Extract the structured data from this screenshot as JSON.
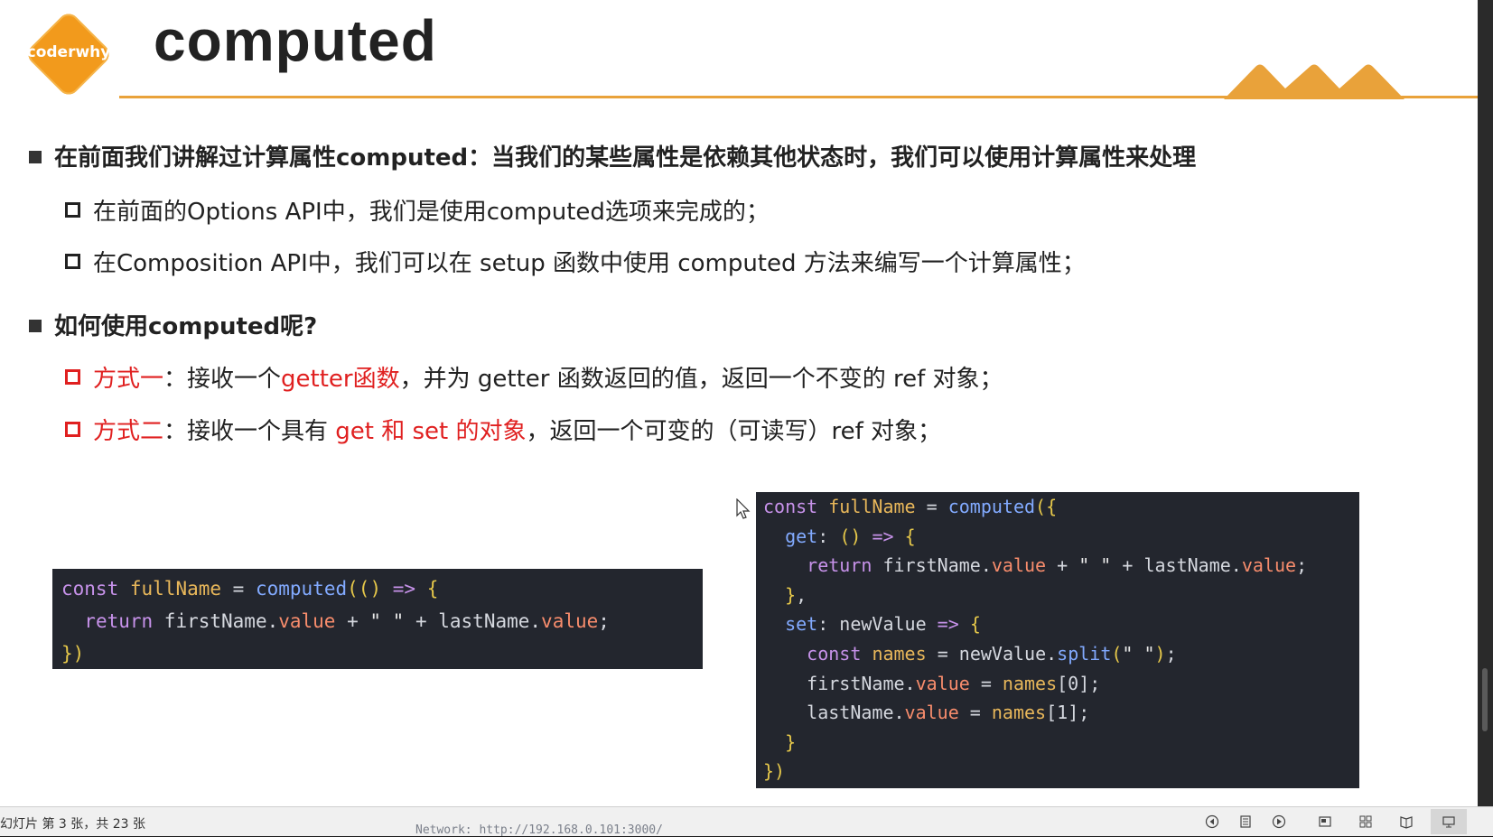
{
  "slide": {
    "logo_text": "coderwhy",
    "title": "computed",
    "bullets": [
      {
        "text": "在前面我们讲解过计算属性computed：当我们的某些属性是依赖其他状态时，我们可以使用计算属性来处理"
      },
      {
        "text": "在前面的Options API中，我们是使用computed选项来完成的；"
      },
      {
        "text": "在Composition API中，我们可以在 setup 函数中使用 computed 方法来编写一个计算属性；"
      },
      {
        "text": "如何使用computed呢?"
      },
      {
        "red1": "方式一",
        "plain1": "：接收一个",
        "red2": "getter函数",
        "plain2": "，并为 getter 函数返回的值，返回一个不变的 ref 对象；"
      },
      {
        "red1": "方式二",
        "plain1": "：接收一个具有 ",
        "red2": "get 和 set 的对象",
        "plain2": "，返回一个可变的（可读写）ref 对象；"
      }
    ],
    "code1": [
      "const fullName = computed(() => {",
      "  return firstName.value + \" \" + lastName.value;",
      "})"
    ],
    "code2": [
      "const fullName = computed({",
      "  get: () => {",
      "    return firstName.value + \" \" + lastName.value;",
      "  },",
      "  set: newValue => {",
      "    const names = newValue.split(\" \");",
      "    firstName.value = names[0];",
      "    lastName.value = names[1];",
      "  }",
      "})"
    ],
    "accent_color": "#e9a23a",
    "logo_color": "#f29a1c",
    "highlight_color": "#e02020"
  },
  "statusbar": {
    "slide_info": "幻灯片 第 3 张，共 23 张",
    "background_text": "Network: http://192.168.0.101:3000/"
  }
}
